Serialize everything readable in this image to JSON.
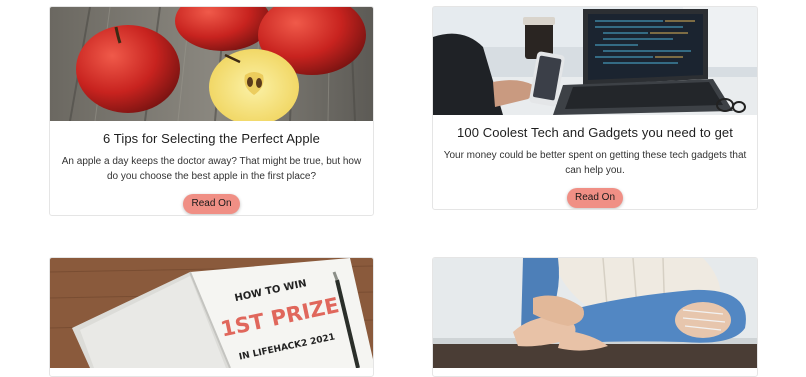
{
  "cards": [
    {
      "title": "6 Tips for Selecting the Perfect Apple",
      "description": "An apple a day keeps the doctor away? That might be true, but how do you choose the best apple in the first place?",
      "button_label": "Read On",
      "image": "apples-photo"
    },
    {
      "title": "100 Coolest Tech and Gadgets you need to get",
      "description": "Your money could be better spent on getting these tech gadgets that can help you.",
      "button_label": "Read On",
      "image": "laptop-phone-photo"
    },
    {
      "title": "",
      "description": "",
      "button_label": "",
      "image": "notebook-photo",
      "image_text": [
        "HOW TO WIN",
        "1ST PRIZE",
        "IN LIFEHACK2 2021"
      ]
    },
    {
      "title": "",
      "description": "",
      "button_label": "",
      "image": "jeans-feet-photo"
    }
  ],
  "colors": {
    "button": "#f08f85",
    "border": "#e5e5e5",
    "notebook_red": "#e0675c"
  }
}
